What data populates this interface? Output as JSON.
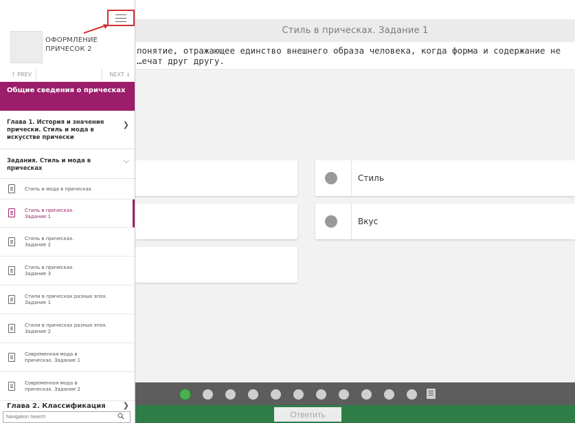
{
  "header": {
    "title": "Стиль в прическах. Задание 1"
  },
  "question": {
    "text": "понятие, отражающее единство внешнего образа человека, когда форма и содержание не …ечат друг другу."
  },
  "answers": [
    {
      "label": "Стиль"
    },
    {
      "label": "Вкус"
    }
  ],
  "pager": {
    "dot_count": 11,
    "active_index": 0
  },
  "footer": {
    "submit_label": "Ответить"
  },
  "sidebar": {
    "course_title": "ОФОРМЛЕНИЕ ПРИЧЕСОК 2",
    "prev_label": "↑ PREV",
    "next_label": "NEXT ↓",
    "section_title": "Общие сведения о прическах",
    "chapter1": "Глава 1. История и значение прически. Стиль и мода в искусстве прически",
    "tasks_group": "Задания. Стиль и мода в прическах",
    "items": [
      {
        "label": "Стиль и мода в прическах"
      },
      {
        "label": "Стиль в прическах. Задание 1"
      },
      {
        "label": "Стиль в прическах. Задание 2"
      },
      {
        "label": "Стиль в прическах. Задание 3"
      },
      {
        "label": "Стили в прическах разных эпох. Задание 1"
      },
      {
        "label": "Стили в прическах разных эпох. Задание 2"
      },
      {
        "label": "Современная мода в прическах. Задание 1"
      },
      {
        "label": "Современная мода в прическах. Задание 2"
      }
    ],
    "chapter2": "Глава 2. Классификация",
    "search_placeholder": "Navigation Search"
  },
  "colors": {
    "accent": "#9c1e6a",
    "footer_green": "#2e7d47",
    "pager_bg": "#5d5d5d",
    "highlight_red": "#d32f2f"
  }
}
